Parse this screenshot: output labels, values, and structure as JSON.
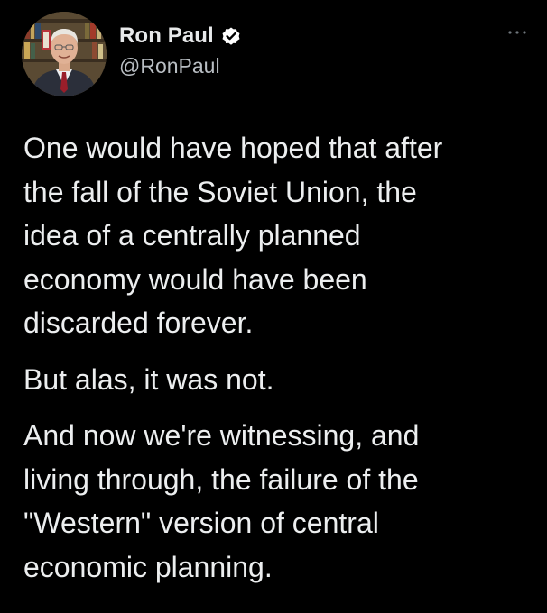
{
  "author": {
    "display_name": "Ron Paul",
    "handle": "@RonPaul",
    "verified": true,
    "avatar_icon": "profile-photo"
  },
  "menu": {
    "more_icon": "more-options-icon"
  },
  "tweet": {
    "paragraphs": [
      "One would have hoped that after\nthe fall of the Soviet Union, the\nidea of a centrally planned\neconomy would have been\ndiscarded forever.",
      "But alas, it was not.",
      "And now we're witnessing, and\nliving through, the failure of the\n\"Western\" version of central\neconomic planning."
    ]
  },
  "colors": {
    "background": "#000000",
    "text": "#e7e9ea",
    "secondary_text": "#b9bec3",
    "verified_badge": "#ffffff"
  }
}
